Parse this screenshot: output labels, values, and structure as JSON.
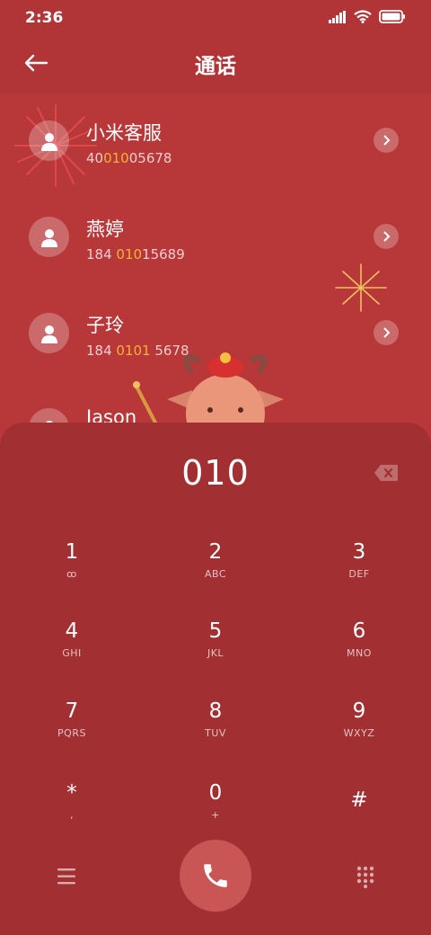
{
  "status_bar": {
    "time": "2:36"
  },
  "header": {
    "title": "通话"
  },
  "contacts": [
    {
      "name": "小米客服",
      "number_pre": "40",
      "number_hl": "010",
      "number_post": "05678"
    },
    {
      "name": "燕婷",
      "number_pre": "184 ",
      "number_hl": "010",
      "number_post": "15689"
    },
    {
      "name": "子玲",
      "number_pre": "184 ",
      "number_hl": "0101",
      "number_post": " 5678"
    },
    {
      "name": "Jason"
    }
  ],
  "dialpad": {
    "input": "010",
    "keys": [
      {
        "num": "1",
        "letters": "ꝏ"
      },
      {
        "num": "2",
        "letters": "ABC"
      },
      {
        "num": "3",
        "letters": "DEF"
      },
      {
        "num": "4",
        "letters": "GHI"
      },
      {
        "num": "5",
        "letters": "JKL"
      },
      {
        "num": "6",
        "letters": "MNO"
      },
      {
        "num": "7",
        "letters": "PQRS"
      },
      {
        "num": "8",
        "letters": "TUV"
      },
      {
        "num": "9",
        "letters": "WXYZ"
      },
      {
        "num": "*",
        "letters": ","
      },
      {
        "num": "0",
        "letters": "+"
      },
      {
        "num": "#",
        "letters": ""
      }
    ]
  },
  "colors": {
    "background": "#b8383a",
    "dialpad": "#a22f32",
    "highlight": "#f5b236",
    "call_button": "#c95555"
  },
  "icons": [
    "signal-icon",
    "wifi-icon",
    "battery-icon",
    "back-arrow-icon",
    "contact-avatar-icon",
    "chevron-right-icon",
    "backspace-icon",
    "menu-icon",
    "phone-icon",
    "dialpad-icon"
  ]
}
